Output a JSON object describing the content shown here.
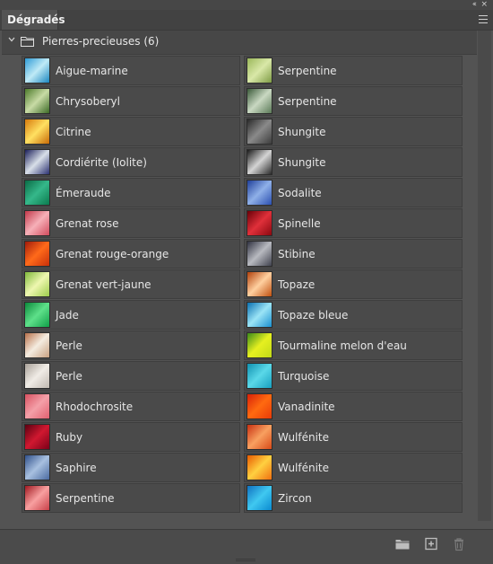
{
  "panel": {
    "tab_label": "Dégradés",
    "collapse_glyph": "‹‹",
    "close_glyph": "×",
    "menu_icon": "hamburger-menu-icon"
  },
  "group": {
    "label": "Pierres-precieuses (6)",
    "expanded": true,
    "icon": "folder-icon"
  },
  "gradients": [
    {
      "label": "Aigue-marine",
      "colors": [
        "#2f9bd6",
        "#bfeaf6",
        "#1a86c0"
      ]
    },
    {
      "label": "Serpentine",
      "colors": [
        "#9bb85a",
        "#d9e8a8",
        "#7e9b45"
      ]
    },
    {
      "label": "Chrysoberyl",
      "colors": [
        "#4c7a2a",
        "#c8dba5",
        "#3b6a25"
      ]
    },
    {
      "label": "Serpentine",
      "colors": [
        "#3b5a3a",
        "#c9d8c2",
        "#5c7a58"
      ]
    },
    {
      "label": "Citrine",
      "colors": [
        "#d77a0c",
        "#ffe061",
        "#c86a06"
      ]
    },
    {
      "label": "Shungite",
      "colors": [
        "#2a2a2a",
        "#8a8a8a",
        "#3c3c3c"
      ]
    },
    {
      "label": "Cordiérite (Iolite)",
      "colors": [
        "#1b1f5a",
        "#d8dfe8",
        "#2a3070"
      ]
    },
    {
      "label": "Shungite",
      "colors": [
        "#1a1a1a",
        "#d4d4d4",
        "#2a2a2a"
      ]
    },
    {
      "label": "Émeraude",
      "colors": [
        "#0a6b45",
        "#35b88a",
        "#0b7a4e"
      ]
    },
    {
      "label": "Sodalite",
      "colors": [
        "#1f3f9a",
        "#8fb0e8",
        "#2b4fb0"
      ]
    },
    {
      "label": "Grenat rose",
      "colors": [
        "#c2384a",
        "#f6b0b8",
        "#d14a5c"
      ]
    },
    {
      "label": "Spinelle",
      "colors": [
        "#6a0008",
        "#e0303a",
        "#8a0810"
      ]
    },
    {
      "label": "Grenat rouge-orange",
      "colors": [
        "#a01a0a",
        "#ff6a1a",
        "#c8300a"
      ]
    },
    {
      "label": "Stibine",
      "colors": [
        "#2f3140",
        "#b8bac0",
        "#40424e"
      ]
    },
    {
      "label": "Grenat vert-jaune",
      "colors": [
        "#7fb83a",
        "#eef7b0",
        "#9ccc4a"
      ]
    },
    {
      "label": "Topaze",
      "colors": [
        "#b0400a",
        "#ffd0a0",
        "#c0500f"
      ]
    },
    {
      "label": "Jade",
      "colors": [
        "#0b8a3a",
        "#5ee08a",
        "#10a048"
      ]
    },
    {
      "label": "Topaze bleue",
      "colors": [
        "#0a70b0",
        "#9be4f6",
        "#1a90d0"
      ]
    },
    {
      "label": "Perle",
      "colors": [
        "#b8704a",
        "#f4ece0",
        "#c8a080"
      ]
    },
    {
      "label": "Tourmaline melon d'eau",
      "colors": [
        "#3a8a1a",
        "#e6f020",
        "#c0d818"
      ]
    },
    {
      "label": "Perle",
      "colors": [
        "#a8a098",
        "#f0ece6",
        "#c0b8b0"
      ]
    },
    {
      "label": "Turquoise",
      "colors": [
        "#1090b0",
        "#5ad8e8",
        "#18a0c0"
      ]
    },
    {
      "label": "Rhodochrosite",
      "colors": [
        "#d85060",
        "#f4a0a8",
        "#e06070"
      ]
    },
    {
      "label": "Vanadinite",
      "colors": [
        "#d82008",
        "#ff6a10",
        "#e83a08"
      ]
    },
    {
      "label": "Ruby",
      "colors": [
        "#5a0010",
        "#d01830",
        "#7a0018"
      ]
    },
    {
      "label": "Wulfénite",
      "colors": [
        "#c83010",
        "#f8a060",
        "#d84a18"
      ]
    },
    {
      "label": "Saphire",
      "colors": [
        "#30508a",
        "#a8c0e0",
        "#4a6aa0"
      ]
    },
    {
      "label": "Wulfénite",
      "colors": [
        "#e85a00",
        "#ffd040",
        "#f07010"
      ]
    },
    {
      "label": "Serpentine",
      "colors": [
        "#a01820",
        "#f8a0a0",
        "#c84048"
      ]
    },
    {
      "label": "Zircon",
      "colors": [
        "#1070c0",
        "#40c8f0",
        "#0a8ad0"
      ]
    }
  ],
  "toolbar": {
    "new_group_icon": "folder-icon",
    "new_item_icon": "plus-box-icon",
    "delete_icon": "trash-icon"
  }
}
